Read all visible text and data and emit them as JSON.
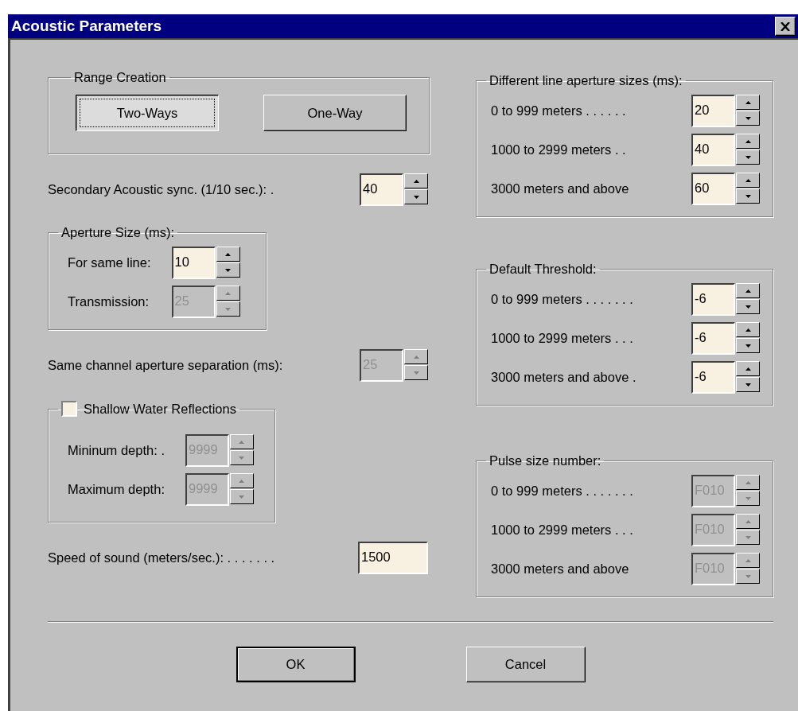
{
  "window": {
    "title": "Acoustic Parameters"
  },
  "left": [
    {
      "kind": "button_group",
      "title": "Range Creation",
      "buttons": [
        {
          "label": "Two-Ways",
          "selected": true
        },
        {
          "label": "One-Way",
          "selected": false
        }
      ]
    },
    {
      "kind": "field",
      "label": "Secondary Acoustic sync. (1/10 sec.): .",
      "value": "40",
      "spinner": true,
      "disabled": false
    },
    {
      "kind": "field_group",
      "title": "Aperture Size (ms):",
      "fields": [
        {
          "label": "For same line:",
          "value": "10",
          "spinner": true,
          "disabled": false
        },
        {
          "label": "Transmission:",
          "value": "25",
          "spinner": true,
          "disabled": true
        }
      ]
    },
    {
      "kind": "field",
      "label": "Same channel aperture separation (ms):",
      "value": "25",
      "spinner": true,
      "disabled": true
    },
    {
      "kind": "check_group",
      "title": "Shallow Water Reflections",
      "checked": false,
      "fields": [
        {
          "label": "Mininum depth: .",
          "value": "9999",
          "spinner": true,
          "disabled": true
        },
        {
          "label": "Maximum depth:",
          "value": "9999",
          "spinner": true,
          "disabled": true
        }
      ]
    },
    {
      "kind": "field",
      "label": "Speed of sound (meters/sec.): . . . . . . .",
      "value": "1500",
      "spinner": false,
      "disabled": false
    }
  ],
  "right": [
    {
      "kind": "field_group",
      "title": "Different line aperture sizes (ms):",
      "fields": [
        {
          "label": "0 to 999 meters . . . . . .",
          "value": "20",
          "spinner": true,
          "disabled": false
        },
        {
          "label": "1000 to 2999 meters . .",
          "value": "40",
          "spinner": true,
          "disabled": false
        },
        {
          "label": "3000 meters and above",
          "value": "60",
          "spinner": true,
          "disabled": false
        }
      ]
    },
    {
      "kind": "field_group",
      "title": "Default Threshold:",
      "fields": [
        {
          "label": "0 to 999 meters . . . . . . .",
          "value": "-6",
          "spinner": true,
          "disabled": false
        },
        {
          "label": "1000 to 2999 meters . . .",
          "value": "-6",
          "spinner": true,
          "disabled": false
        },
        {
          "label": "3000 meters and above .",
          "value": "-6",
          "spinner": true,
          "disabled": false
        }
      ]
    },
    {
      "kind": "field_group",
      "title": "Pulse size number:",
      "fields": [
        {
          "label": "0 to 999 meters . . . . . . .",
          "value": "F010",
          "spinner": true,
          "disabled": true
        },
        {
          "label": "1000 to 2999 meters . . .",
          "value": "F010",
          "spinner": true,
          "disabled": true
        },
        {
          "label": "3000 meters and above",
          "value": "F010",
          "spinner": true,
          "disabled": true
        }
      ]
    }
  ],
  "buttons": [
    {
      "label": "OK",
      "default": true
    },
    {
      "label": "Cancel",
      "default": false
    }
  ]
}
